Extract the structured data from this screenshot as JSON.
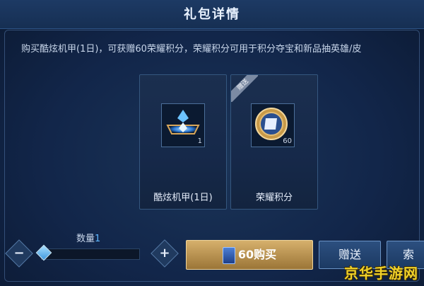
{
  "header": {
    "title": "礼包详情"
  },
  "description": "购买酷炫机甲(1日)，可获赠60荣耀积分，荣耀积分可用于积分夺宝和新品抽英雄/皮",
  "items": [
    {
      "name": "酷炫机甲(1日)",
      "quantity": "1",
      "icon": "mech-icon",
      "tag": ""
    },
    {
      "name": "荣耀积分",
      "quantity": "60",
      "icon": "honor-points-icon",
      "tag": "赠送"
    }
  ],
  "quantity": {
    "label": "数量",
    "value": "1",
    "fill": 0
  },
  "actions": {
    "buy_label": "60购买",
    "gift_label": "赠送",
    "third_label": "索"
  },
  "watermark": "京华手游网",
  "colors": {
    "accent": "#5fb7ff",
    "buy": "#c9a25d",
    "watermark": "#f0d12a"
  }
}
